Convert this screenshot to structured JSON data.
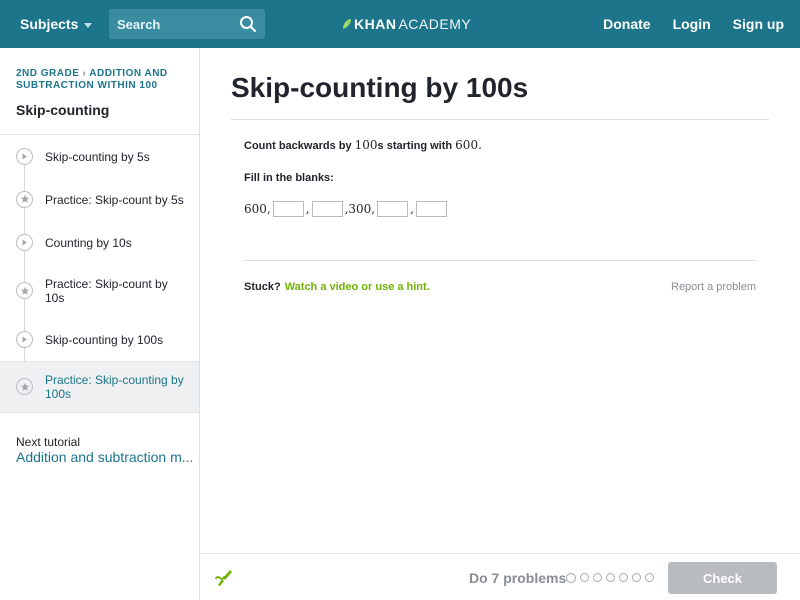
{
  "header": {
    "subjects_label": "Subjects",
    "search_placeholder": "Search",
    "logo_bold": "KHAN",
    "logo_light": "ACADEMY",
    "donate_label": "Donate",
    "login_label": "Login",
    "signup_label": "Sign up",
    "bg_color": "#1c758a"
  },
  "sidebar": {
    "breadcrumb_grade": "2nd grade",
    "breadcrumb_unit": "Addition and subtraction within 100",
    "title": "Skip-counting",
    "items": [
      {
        "label": "Skip-counting by 5s",
        "icon": "play-icon"
      },
      {
        "label": "Practice: Skip-count by 5s",
        "icon": "star-icon"
      },
      {
        "label": "Counting by 10s",
        "icon": "play-icon"
      },
      {
        "label": "Practice: Skip-count by 10s",
        "icon": "star-icon"
      },
      {
        "label": "Skip-counting by 100s",
        "icon": "play-icon"
      },
      {
        "label": "Practice: Skip-counting by 100s",
        "icon": "star-icon",
        "active": true
      }
    ],
    "next_label": "Next tutorial",
    "next_link": "Addition and subtraction m..."
  },
  "main": {
    "title": "Skip-counting by 100s",
    "prompt_pre": "Count backwards by",
    "prompt_step": "100",
    "prompt_mid": "s starting with",
    "prompt_start": "600",
    "prompt_end": ".",
    "fill_label": "Fill in the blanks:",
    "seq_first": "600",
    "seq_known": "300",
    "stuck_label": "Stuck?",
    "stuck_link": "Watch a video or use a hint.",
    "report_label": "Report a problem"
  },
  "footer": {
    "do_count_label": "Do 7 problems",
    "problem_count": 7,
    "check_label": "Check"
  }
}
